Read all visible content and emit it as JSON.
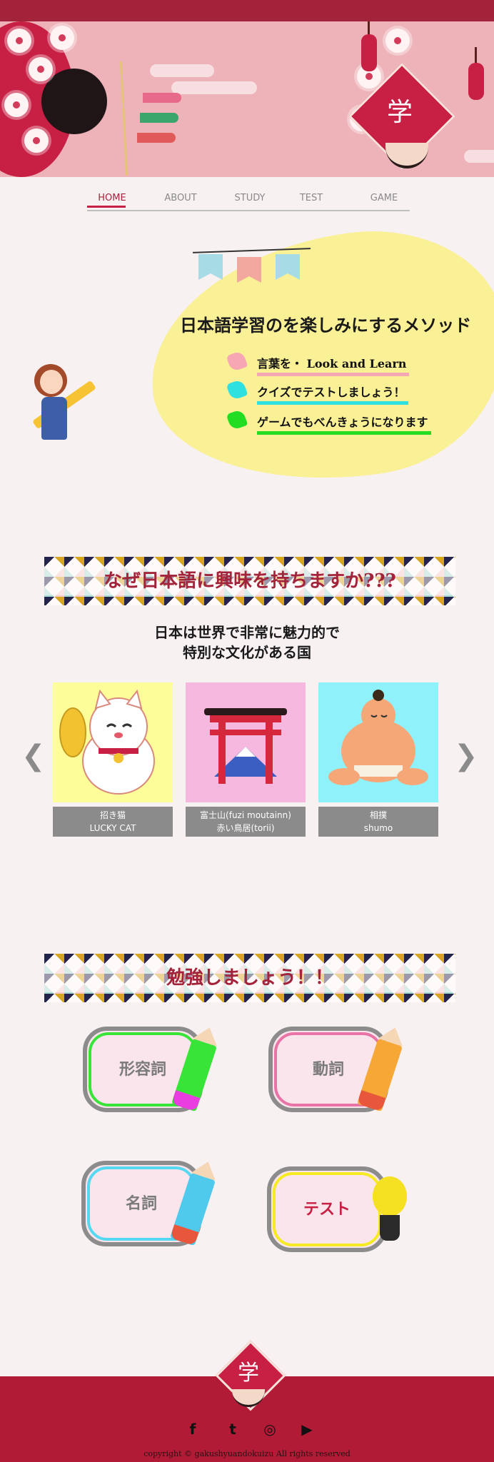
{
  "header": {
    "emblem_char": "学",
    "colors": {
      "topstrip": "#a3243a",
      "hero_bg": "#eeb3b8",
      "accent": "#c81f44"
    }
  },
  "nav": {
    "items": [
      {
        "label": "HOME",
        "active": true
      },
      {
        "label": "ABOUT",
        "active": false
      },
      {
        "label": "STUDY",
        "active": false
      },
      {
        "label": "TEST",
        "active": false
      },
      {
        "label": "GAME",
        "active": false
      }
    ]
  },
  "intro": {
    "title": "日本語学習のを楽しみにするメソッド",
    "bullets": [
      {
        "text": "言葉を・ Look and Learn",
        "color": "#f6a7b3"
      },
      {
        "text": "クイズでテストしましょう！",
        "color": "#2ee0e0"
      },
      {
        "text": "ゲームでもべんきょうになります",
        "color": "#22dd22"
      }
    ]
  },
  "why": {
    "banner_title": "なぜ日本語に興味を持ちますか???",
    "subtitle_line1": "日本は世界で非常に魅力的で",
    "subtitle_line2": "特別な文化がある国",
    "prev_arrow": "❮",
    "next_arrow": "❯",
    "cards": [
      {
        "line1": "招き猫",
        "line2": "LUCKY CAT",
        "icon": "lucky-cat-icon",
        "bg": "#fdfd9a"
      },
      {
        "line1": "富士山(fuzi moutainn)",
        "line2": "赤い鳥居(torii)",
        "icon": "torii-icon",
        "bg": "#f6b8de"
      },
      {
        "line1": "相撲",
        "line2": "shumo",
        "icon": "sumo-icon",
        "bg": "#8ff2fa"
      }
    ]
  },
  "study": {
    "banner_title": "勉強しましょう！！",
    "buttons": [
      {
        "label": "形容詞",
        "border": "#37e437",
        "pencil": "#37e437"
      },
      {
        "label": "動詞",
        "border": "#e873a6",
        "pencil": "#f6a735"
      },
      {
        "label": "名詞",
        "border": "#55d8f2",
        "pencil": "#4fc9ec"
      },
      {
        "label": "テスト",
        "border": "#f6ea22",
        "pencil": "#f6e022"
      }
    ]
  },
  "footer": {
    "emblem_char": "学",
    "social": [
      "f",
      "t",
      "◎",
      "▶"
    ],
    "social_icons": [
      "facebook-icon",
      "twitter-icon",
      "instagram-icon",
      "youtube-icon"
    ],
    "copyright": "copyright © gakushyuandokuizu All rights reserved"
  }
}
